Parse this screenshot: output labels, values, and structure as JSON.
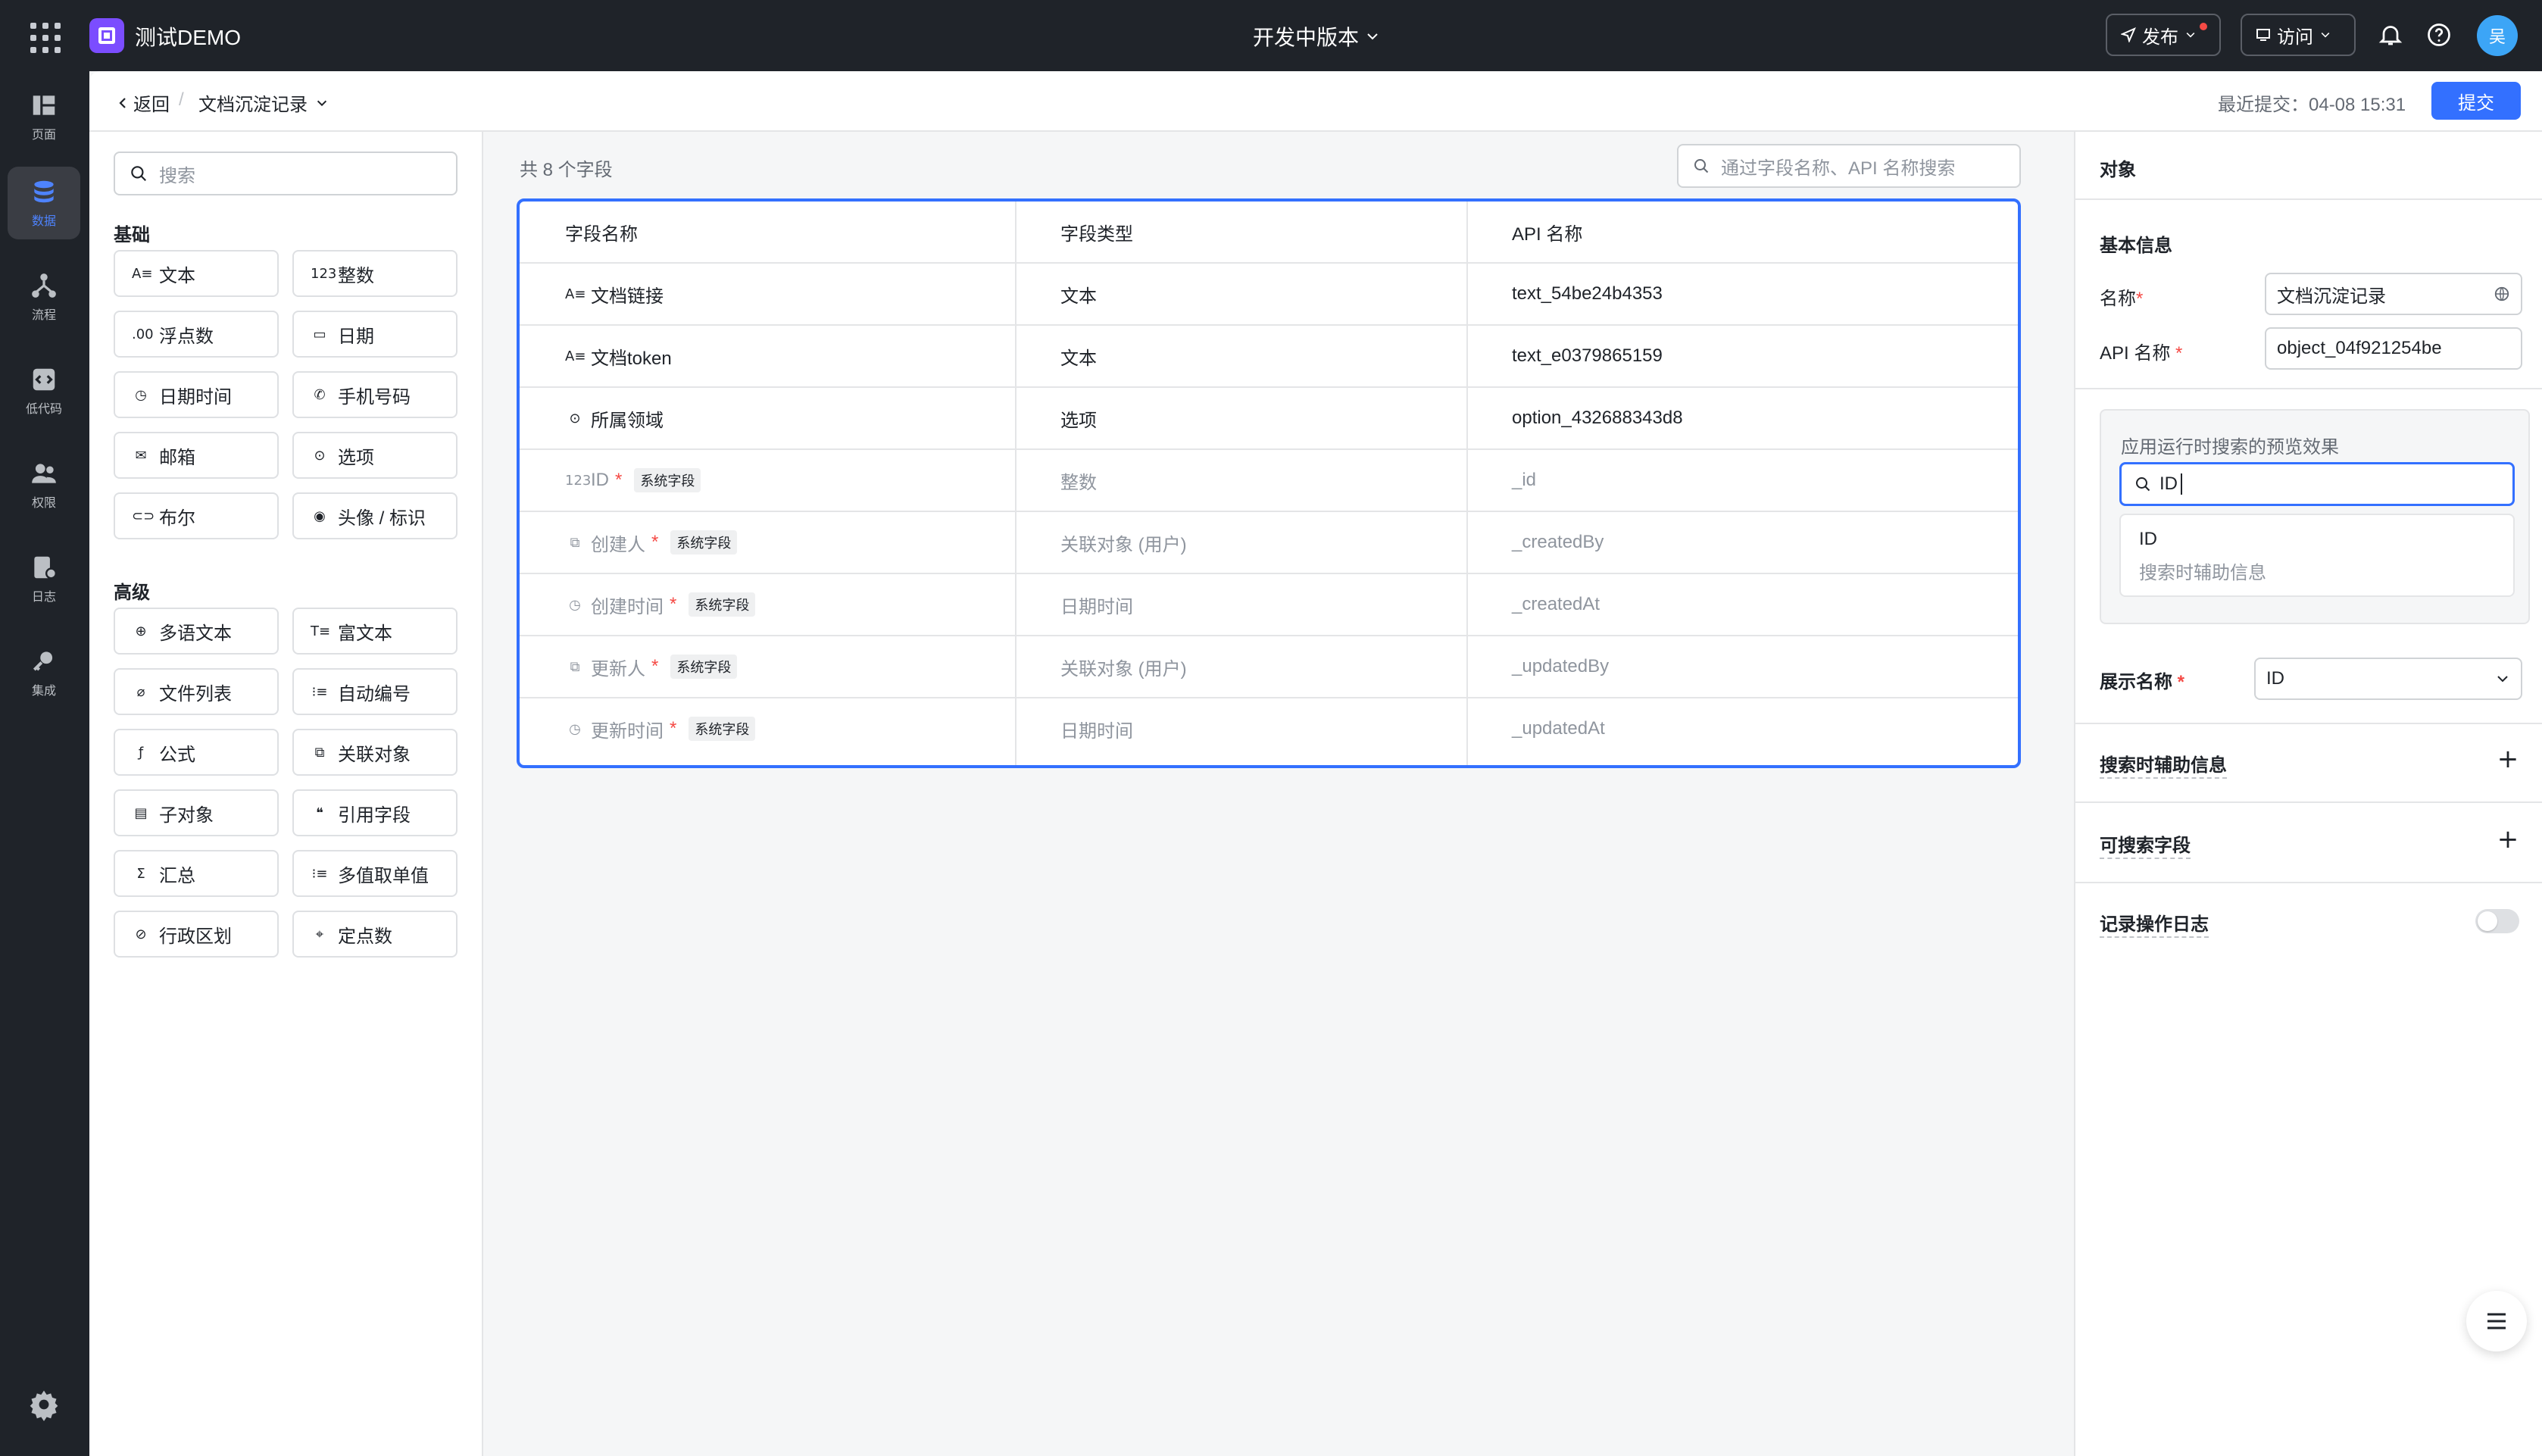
{
  "topbar": {
    "app_name": "测试DEMO",
    "version": "开发中版本",
    "publish_label": "发布",
    "visit_label": "访问",
    "avatar_text": "吴"
  },
  "rail": {
    "items": [
      {
        "label": "页面",
        "icon": "page-icon"
      },
      {
        "label": "数据",
        "icon": "database-icon",
        "active": true
      },
      {
        "label": "流程",
        "icon": "flow-icon"
      },
      {
        "label": "低代码",
        "icon": "code-icon"
      },
      {
        "label": "权限",
        "icon": "users-icon"
      },
      {
        "label": "日志",
        "icon": "log-icon"
      },
      {
        "label": "集成",
        "icon": "key-icon"
      }
    ]
  },
  "subheader": {
    "back_label": "返回",
    "crumb_sep": "/",
    "object_name": "文档沉淀记录",
    "last_commit": "最近提交：04-08 15:31",
    "submit_label": "提交"
  },
  "palette": {
    "search_placeholder": "搜索",
    "basic_title": "基础",
    "advanced_title": "高级",
    "basic": [
      {
        "label": "文本",
        "glyph": "A≡"
      },
      {
        "label": "整数",
        "glyph": "123"
      },
      {
        "label": "浮点数",
        "glyph": ".00"
      },
      {
        "label": "日期",
        "glyph": "▭"
      },
      {
        "label": "日期时间",
        "glyph": "◷"
      },
      {
        "label": "手机号码",
        "glyph": "✆"
      },
      {
        "label": "邮箱",
        "glyph": "✉"
      },
      {
        "label": "选项",
        "glyph": "⊙"
      },
      {
        "label": "布尔",
        "glyph": "⊂⊃"
      },
      {
        "label": "头像 / 标识",
        "glyph": "◉"
      }
    ],
    "advanced": [
      {
        "label": "多语文本",
        "glyph": "⊕"
      },
      {
        "label": "富文本",
        "glyph": "T≡"
      },
      {
        "label": "文件列表",
        "glyph": "⌀"
      },
      {
        "label": "自动编号",
        "glyph": "⁝≡"
      },
      {
        "label": "公式",
        "glyph": "ƒ"
      },
      {
        "label": "关联对象",
        "glyph": "⧉"
      },
      {
        "label": "子对象",
        "glyph": "▤"
      },
      {
        "label": "引用字段",
        "glyph": "❝"
      },
      {
        "label": "汇总",
        "glyph": "Σ"
      },
      {
        "label": "多值取单值",
        "glyph": "⁝≡"
      },
      {
        "label": "行政区划",
        "glyph": "⊘"
      },
      {
        "label": "定点数",
        "glyph": "⌖"
      }
    ]
  },
  "center": {
    "count_text": "共 8 个字段",
    "search_placeholder": "通过字段名称、API 名称搜索",
    "columns": [
      "字段名称",
      "字段类型",
      "API 名称"
    ],
    "sys_tag": "系统字段",
    "rows": [
      {
        "name": "文档链接",
        "glyph": "A≡",
        "type": "文本",
        "api": "text_54be24b4353",
        "system": false,
        "required": false
      },
      {
        "name": "文档token",
        "glyph": "A≡",
        "type": "文本",
        "api": "text_e0379865159",
        "system": false,
        "required": false
      },
      {
        "name": "所属领域",
        "glyph": "⊙",
        "type": "选项",
        "api": "option_432688343d8",
        "system": false,
        "required": false
      },
      {
        "name": "ID",
        "glyph": "123",
        "type": "整数",
        "api": "_id",
        "system": true,
        "required": true
      },
      {
        "name": "创建人",
        "glyph": "⧉",
        "type": "关联对象 (用户)",
        "api": "_createdBy",
        "system": true,
        "required": true
      },
      {
        "name": "创建时间",
        "glyph": "◷",
        "type": "日期时间",
        "api": "_createdAt",
        "system": true,
        "required": true
      },
      {
        "name": "更新人",
        "glyph": "⧉",
        "type": "关联对象 (用户)",
        "api": "_updatedBy",
        "system": true,
        "required": true
      },
      {
        "name": "更新时间",
        "glyph": "◷",
        "type": "日期时间",
        "api": "_updatedAt",
        "system": true,
        "required": true
      }
    ]
  },
  "right": {
    "title": "对象",
    "basic_info": "基本信息",
    "name_label": "名称",
    "name_value": "文档沉淀记录",
    "api_label": "API 名称",
    "api_value": "object_04f921254be",
    "required_mark": "*",
    "preview_title": "应用运行时搜索的预览效果",
    "preview_query": "ID",
    "preview_result_main": "ID",
    "preview_result_sub": "搜索时辅助信息",
    "display_name_label": "展示名称",
    "display_name_value": "ID",
    "search_aux_label": "搜索时辅助信息",
    "searchable_label": "可搜索字段",
    "log_label": "记录操作日志",
    "log_enabled": false
  },
  "colors": {
    "accent": "#3370ff",
    "topbar_bg": "#1f2329",
    "danger": "#f54a45",
    "brand_logo": "#7b4dff",
    "avatar": "#3ca5f6"
  }
}
